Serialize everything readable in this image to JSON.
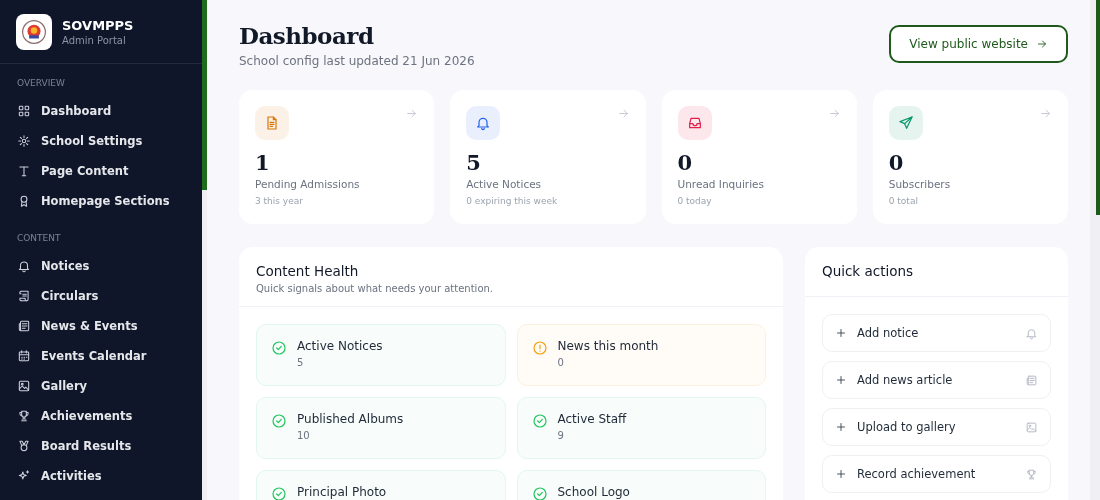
{
  "brand": {
    "name": "SOVMPPS",
    "subtitle": "Admin Portal"
  },
  "sidebar": {
    "sections": [
      {
        "title": "OVERVIEW",
        "items": [
          {
            "label": "Dashboard"
          },
          {
            "label": "School Settings"
          },
          {
            "label": "Page Content"
          },
          {
            "label": "Homepage Sections"
          }
        ]
      },
      {
        "title": "CONTENT",
        "items": [
          {
            "label": "Notices"
          },
          {
            "label": "Circulars"
          },
          {
            "label": "News & Events"
          },
          {
            "label": "Events Calendar"
          },
          {
            "label": "Gallery"
          },
          {
            "label": "Achievements"
          },
          {
            "label": "Board Results"
          },
          {
            "label": "Activities"
          }
        ]
      }
    ]
  },
  "header": {
    "title": "Dashboard",
    "subtitle": "School config last updated 21 Jun 2026",
    "button": "View public website"
  },
  "stats": [
    {
      "value": "1",
      "label": "Pending Admissions",
      "note": "3 this year",
      "color": "#d97706"
    },
    {
      "value": "5",
      "label": "Active Notices",
      "note": "0 expiring this week",
      "color": "#2563eb"
    },
    {
      "value": "0",
      "label": "Unread Inquiries",
      "note": "0 today",
      "color": "#e11d48"
    },
    {
      "value": "0",
      "label": "Subscribers",
      "note": "0 total",
      "color": "#059669"
    }
  ],
  "content_health": {
    "title": "Content Health",
    "subtitle": "Quick signals about what needs your attention.",
    "items": [
      {
        "label": "Active Notices",
        "value": "5",
        "kind": "ok"
      },
      {
        "label": "News this month",
        "value": "0",
        "kind": "warning"
      },
      {
        "label": "Published Albums",
        "value": "10",
        "kind": "ok"
      },
      {
        "label": "Active Staff",
        "value": "9",
        "kind": "ok"
      },
      {
        "label": "Principal Photo",
        "kind": "ok"
      },
      {
        "label": "School Logo",
        "kind": "ok"
      }
    ]
  },
  "quick_actions": {
    "title": "Quick actions",
    "items": [
      {
        "label": "Add notice"
      },
      {
        "label": "Add news article"
      },
      {
        "label": "Upload to gallery"
      },
      {
        "label": "Record achievement"
      }
    ]
  }
}
